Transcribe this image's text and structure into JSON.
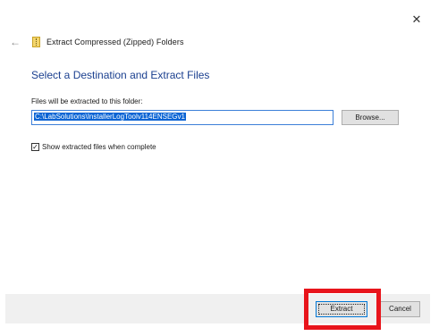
{
  "window": {
    "title": "Extract Compressed (Zipped) Folders",
    "close_glyph": "✕",
    "back_glyph": "←"
  },
  "main": {
    "heading": "Select a Destination and Extract Files",
    "field_label": "Files will be extracted to this folder:",
    "path_value": "C:\\LabSolutions\\InstallerLogToolv114ENSEGv1",
    "browse_label": "Browse...",
    "show_files_label": "Show extracted files when complete",
    "show_files_checked": true
  },
  "footer": {
    "extract_label": "Extract",
    "cancel_label": "Cancel"
  },
  "colors": {
    "heading": "#1a3f8f",
    "highlight": "#e8141b",
    "selection": "#0a64d4"
  }
}
